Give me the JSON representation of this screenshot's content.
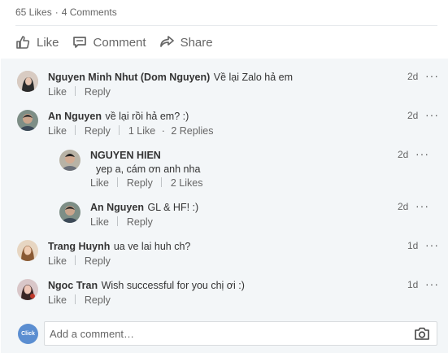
{
  "stats": {
    "likes": "65 Likes",
    "separator": "·",
    "comments": "4 Comments"
  },
  "actions": {
    "like": "Like",
    "comment": "Comment",
    "share": "Share"
  },
  "comments": [
    {
      "name": "Nguyen Minh Nhut (Dom Nguyen)",
      "text": "Về lại Zalo hả em",
      "time": "2d",
      "like": "Like",
      "reply": "Reply"
    },
    {
      "name": "An Nguyen",
      "text": "về lại rồi hả em? :)",
      "time": "2d",
      "like": "Like",
      "reply": "Reply",
      "likes_count": "1 Like",
      "replies_count": "2 Replies"
    },
    {
      "name": "NGUYEN HIEN",
      "text": "yep a, cám ơn anh nha",
      "time": "2d",
      "like": "Like",
      "reply": "Reply",
      "likes_count": "2 Likes"
    },
    {
      "name": "An Nguyen",
      "text": "GL & HF! :)",
      "time": "2d",
      "like": "Like",
      "reply": "Reply"
    },
    {
      "name": "Trang Huynh",
      "text": "ua ve lai huh ch?",
      "time": "1d",
      "like": "Like",
      "reply": "Reply"
    },
    {
      "name": "Ngoc Tran",
      "text": "Wish successful for you chị ơi :)",
      "time": "1d",
      "like": "Like",
      "reply": "Reply"
    }
  ],
  "more_glyph": "···",
  "composer": {
    "avatar_text": "Click",
    "placeholder": "Add a comment…"
  },
  "colors": {
    "panel": "#f3f6f8",
    "avatar_blue": "#5b8ed1"
  },
  "icons": {
    "like": "thumbs-up-icon",
    "comment": "comment-icon",
    "share": "share-icon",
    "camera": "camera-icon"
  }
}
